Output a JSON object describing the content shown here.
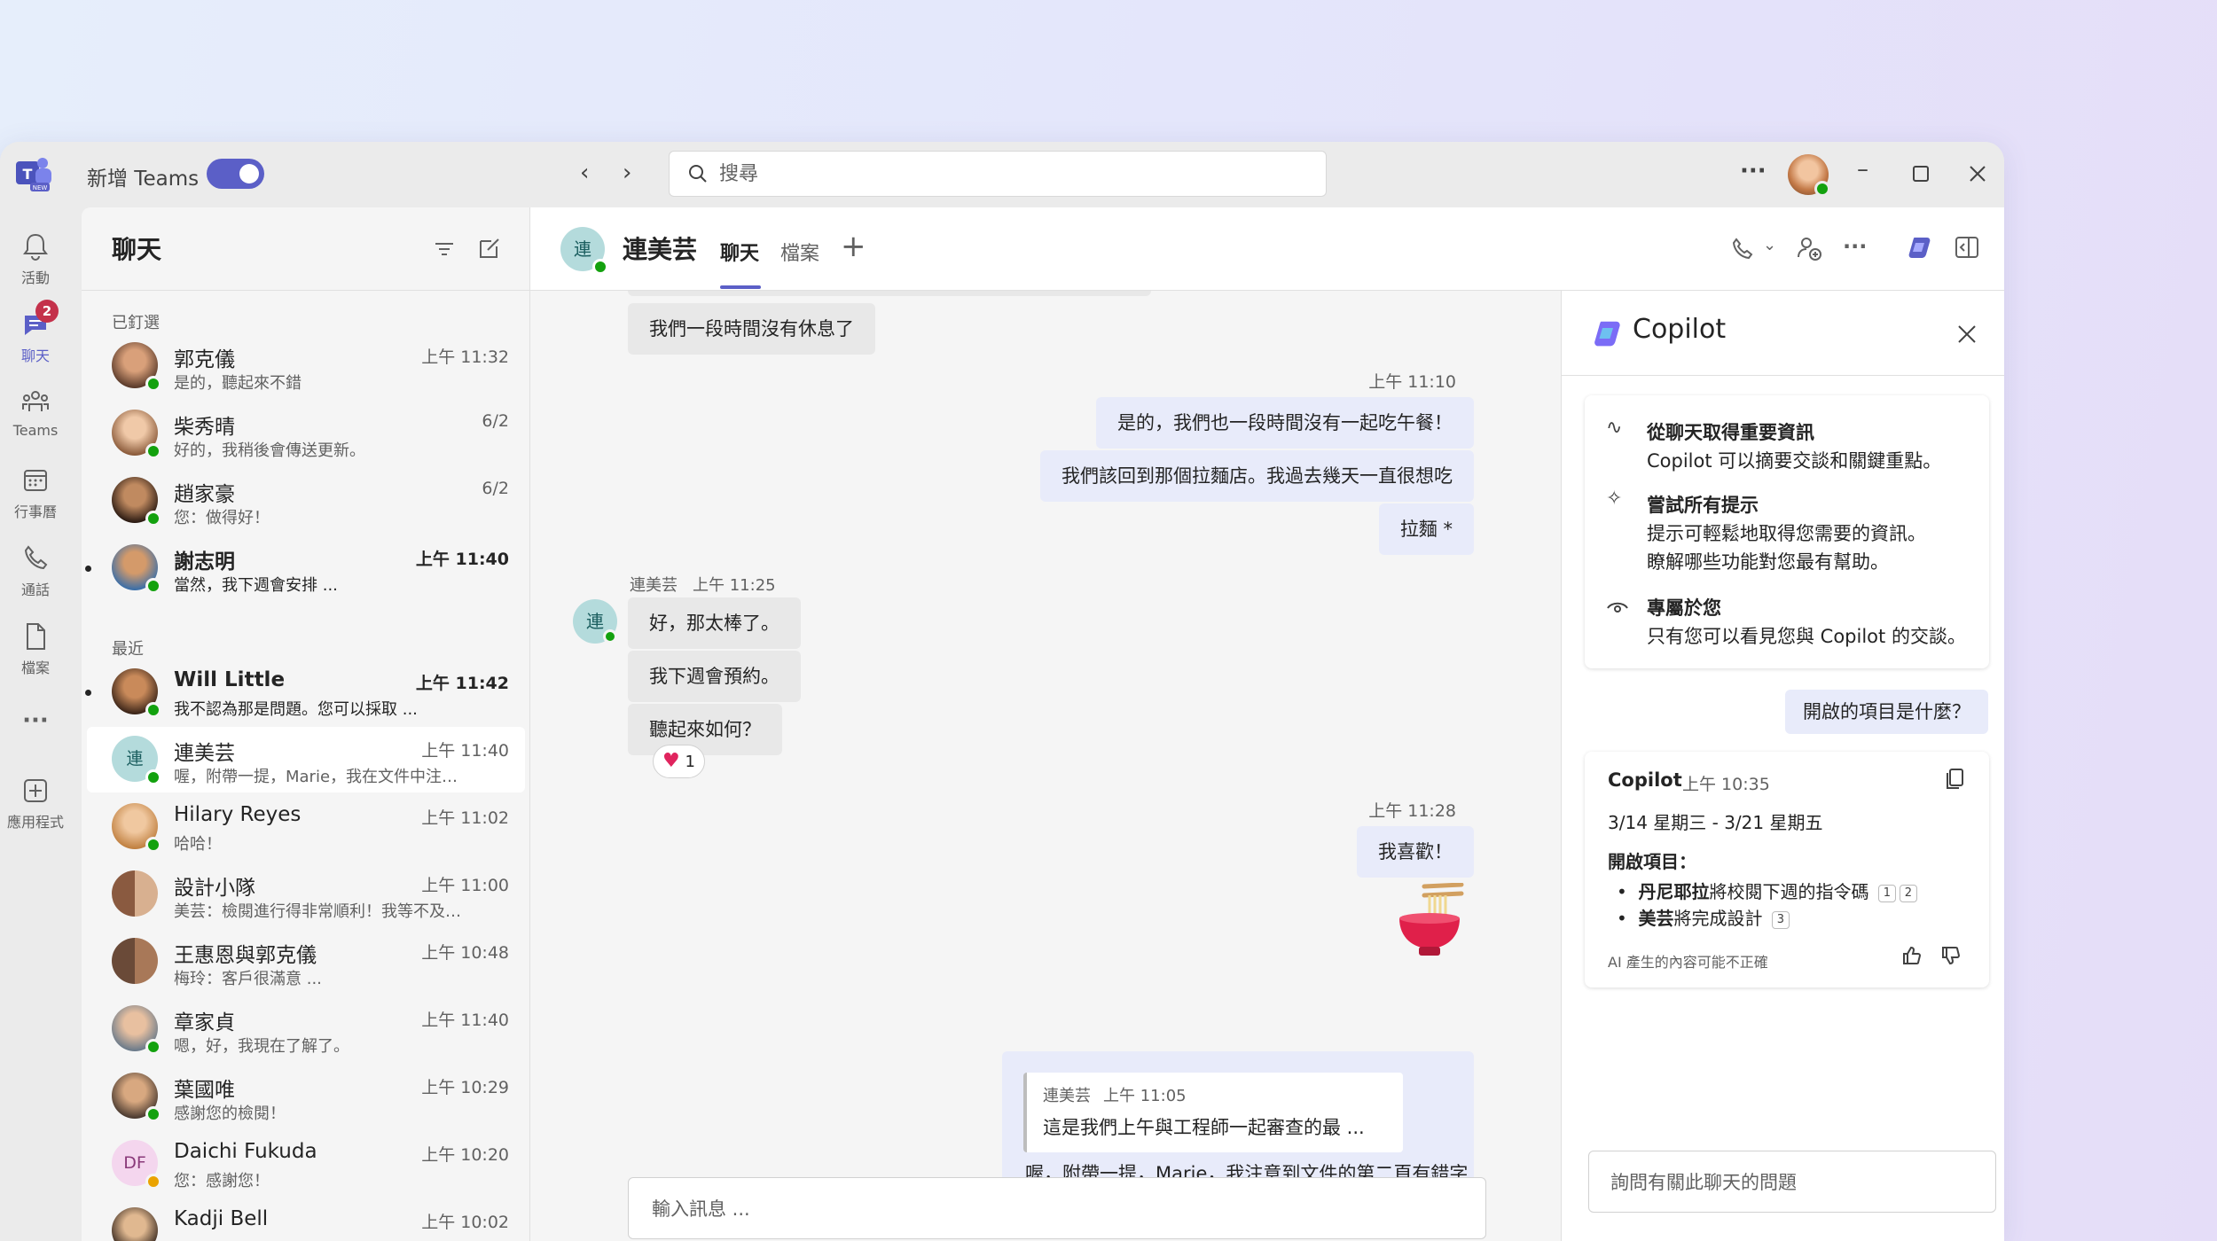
{
  "titlebar": {
    "new_teams_label": "新增 Teams",
    "search_placeholder": "搜尋",
    "more_label": "···"
  },
  "rail": {
    "items": [
      {
        "label": "活動",
        "icon": "bell-icon"
      },
      {
        "label": "聊天",
        "icon": "chat-icon",
        "badge": "2"
      },
      {
        "label": "Teams",
        "icon": "teams-icon"
      },
      {
        "label": "行事曆",
        "icon": "calendar-icon"
      },
      {
        "label": "通話",
        "icon": "phone-icon"
      },
      {
        "label": "檔案",
        "icon": "file-icon"
      },
      {
        "label": "···",
        "icon": "more-icon"
      },
      {
        "label": "應用程式",
        "icon": "add-apps-icon"
      }
    ]
  },
  "chatlist": {
    "title": "聊天",
    "pinned_label": "已釘選",
    "recent_label": "最近",
    "pinned": [
      {
        "name": "郭克儀",
        "time": "上午 11:32",
        "preview": "是的，聽起來不錯",
        "unread": false
      },
      {
        "name": "柴秀晴",
        "time": "6/2",
        "preview": "好的，我稍後會傳送更新。",
        "unread": false
      },
      {
        "name": "趙家豪",
        "time": "6/2",
        "preview": "您：做得好！",
        "unread": false
      },
      {
        "name": "謝志明",
        "time": "上午 11:40",
        "preview": "當然，我下週會安排 ...",
        "unread": true
      }
    ],
    "recent": [
      {
        "name": "Will Little",
        "time": "上午 11:42",
        "preview": "我不認為那是問題。您可以採取 ...",
        "unread": true
      },
      {
        "name": "連美芸",
        "time": "上午 11:40",
        "preview": "喔，附帶一提，Marie，我在文件中注意到 ...",
        "unread": false,
        "initial": "連"
      },
      {
        "name": "Hilary Reyes",
        "time": "上午 11:02",
        "preview": "哈哈！",
        "unread": false
      },
      {
        "name": "設計小隊",
        "time": "上午 11:00",
        "preview": "美芸：檢閱進行得非常順利！我等不及了...",
        "unread": false
      },
      {
        "name": "王惠恩與郭克儀",
        "time": "上午 10:48",
        "preview": "梅玲：客戶很滿意 ...",
        "unread": false
      },
      {
        "name": "章家貞",
        "time": "上午 11:40",
        "preview": "嗯，好，我現在了解了。",
        "unread": false
      },
      {
        "name": "葉國唯",
        "time": "上午 10:29",
        "preview": "感謝您的檢閱！",
        "unread": false
      },
      {
        "name": "Daichi Fukuda",
        "time": "上午 10:20",
        "preview": "您：感謝您！",
        "unread": false,
        "initial": "DF"
      },
      {
        "name": "Kadji Bell",
        "time": "上午 10:02",
        "preview": "",
        "unread": false
      }
    ]
  },
  "chat": {
    "contact_initial": "連",
    "contact_name": "連美芸",
    "tabs": [
      "聊天",
      "檔案"
    ],
    "add_tab": "+",
    "messages": {
      "m0": "我們一段時間沒有休息了",
      "t1": "上午 11:10",
      "m1": "是的，我們也一段時間沒有一起吃午餐！",
      "m2": "我們該回到那個拉麵店。我過去幾天一直很想吃",
      "m3": "拉麵 *",
      "sender": "連美芸",
      "sender_time": "上午 11:25",
      "m4": "好，那太棒了。",
      "m5": "我下週會預約。",
      "m6": "聽起來如何？",
      "reaction_count": "1",
      "t2": "上午 11:28",
      "m7": "我喜歡！",
      "quote_sender": "連美芸",
      "quote_time": "上午 11:05",
      "quote_text": "這是我們上午與工程師一起審查的最 ...",
      "m8": "喔，附帶一提，Marie，我注意到文件的第二頁有錯字"
    },
    "compose_placeholder": "輸入訊息 ..."
  },
  "copilot": {
    "title": "Copilot",
    "features": [
      {
        "title": "從聊天取得重要資訊",
        "desc1": "Copilot 可以摘要交談和關鍵重點。",
        "desc2": ""
      },
      {
        "title": "嘗試所有提示",
        "desc1": "提示可輕鬆地取得您需要的資訊。",
        "desc2": "瞭解哪些功能對您最有幫助。"
      },
      {
        "title": "專屬於您",
        "desc1": "只有您可以看見您與 Copilot 的交談。",
        "desc2": ""
      }
    ],
    "user_prompt": "開啟的項目是什麼？",
    "response": {
      "author": "Copilot",
      "time": "上午 10:35",
      "range": "3/14 星期三 - 3/21 星期五",
      "heading": "開啟項目：",
      "item1_bold": "丹尼耶拉",
      "item1_rest": "將校閱下週的指令碼",
      "item2_bold": "美芸",
      "item2_rest": "將完成設計",
      "cite1": "1",
      "cite2": "2",
      "cite3": "3",
      "disclaimer": "AI 產生的內容可能不正確"
    },
    "ask_placeholder": "詢問有關此聊天的問題"
  },
  "colors": {
    "accent": "#5b5fc7",
    "online": "#13a10e",
    "away": "#eaa300",
    "badge": "#c4314b"
  }
}
